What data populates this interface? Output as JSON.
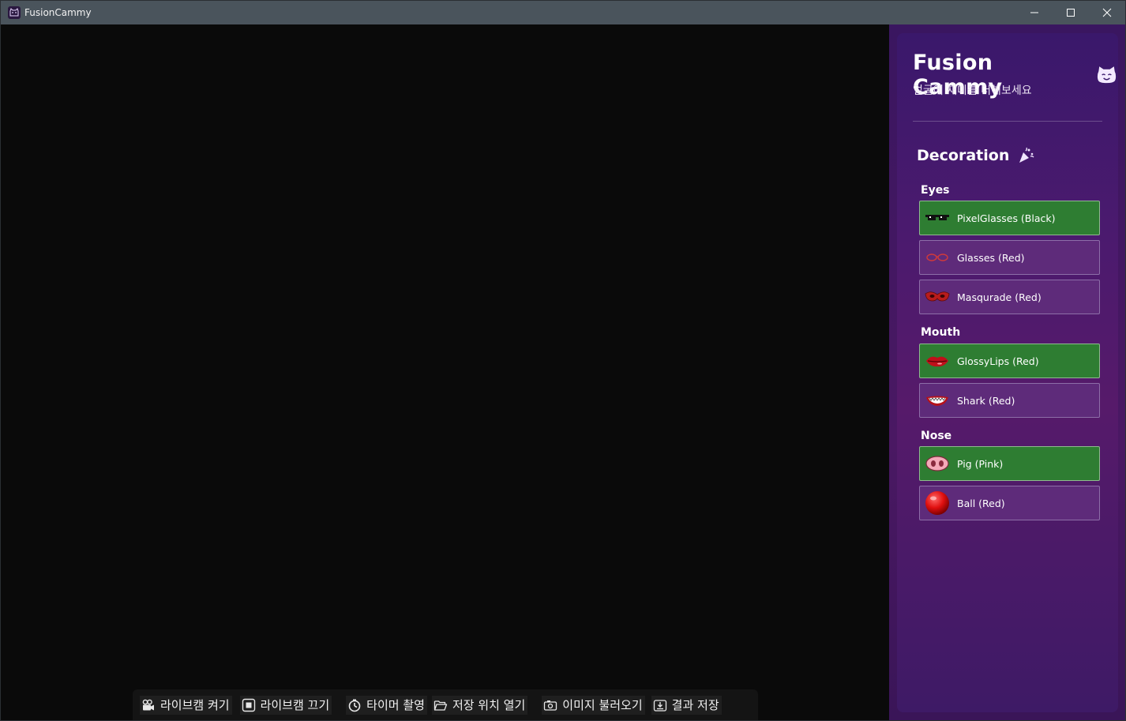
{
  "window": {
    "title": "FusionCammy",
    "controls": {
      "minimize": "minimize-icon",
      "maximize": "maximize-icon",
      "close": "close-icon"
    }
  },
  "toolbar": {
    "buttons": [
      {
        "label": "라이브캠 켜기",
        "icon": "camcorder-icon"
      },
      {
        "label": "라이브캠 끄기",
        "icon": "stop-icon"
      },
      {
        "label": "타이머 촬영",
        "icon": "timer-icon"
      },
      {
        "label": "저장 위치 열기",
        "icon": "folder-icon"
      },
      {
        "label": "이미지 불러오기",
        "icon": "camera-icon"
      },
      {
        "label": "결과 저장",
        "icon": "save-icon"
      }
    ]
  },
  "sidebar": {
    "title": "Fusion Cammy",
    "subtitle": "얼굴에 재미를 더해보세요",
    "section": "Decoration",
    "groups": [
      {
        "label": "Eyes",
        "items": [
          {
            "label": "PixelGlasses (Black)",
            "selected": true
          },
          {
            "label": "Glasses (Red)",
            "selected": false
          },
          {
            "label": "Masqurade (Red)",
            "selected": false
          }
        ]
      },
      {
        "label": "Mouth",
        "items": [
          {
            "label": "GlossyLips (Red)",
            "selected": true
          },
          {
            "label": "Shark (Red)",
            "selected": false
          }
        ]
      },
      {
        "label": "Nose",
        "items": [
          {
            "label": "Pig (Pink)",
            "selected": true
          },
          {
            "label": "Ball (Red)",
            "selected": false
          }
        ]
      }
    ]
  },
  "colors": {
    "selected": "#2e7d32",
    "unselected": "#5e2b7a",
    "panel": "#4b1a6e",
    "titlebar": "#4a545c"
  }
}
